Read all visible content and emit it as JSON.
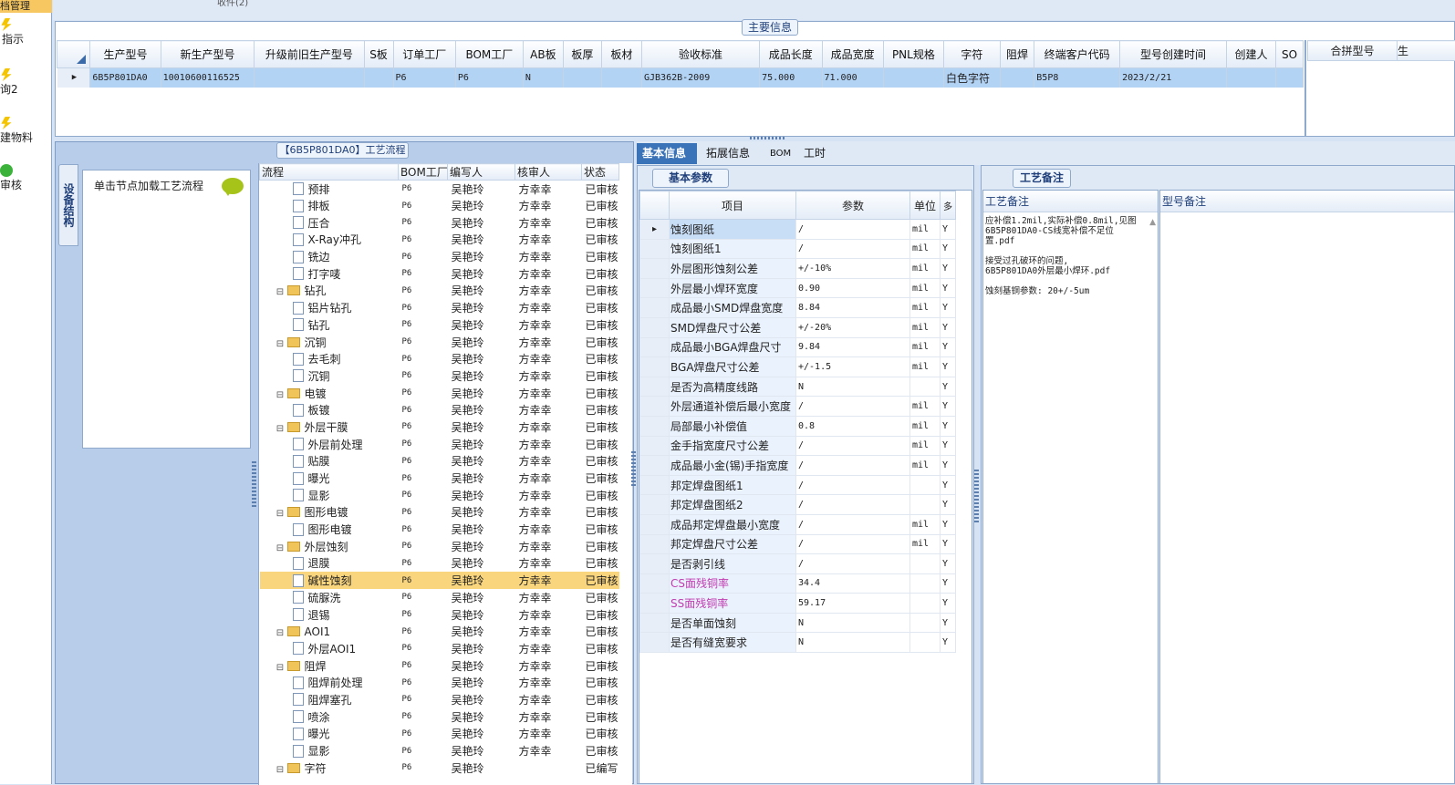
{
  "leftnav": {
    "top_label": "档管理",
    "items": [
      "指示",
      "询2",
      "建物料",
      "审核"
    ]
  },
  "topstrip": {
    "text": "收件(2)"
  },
  "main": {
    "title": "主要信息",
    "columns": [
      "生产型号",
      "新生产型号",
      "升级前旧生产型号",
      "S板",
      "订单工厂",
      "BOM工厂",
      "AB板",
      "板厚",
      "板材",
      "验收标准",
      "成品长度",
      "成品宽度",
      "PNL规格",
      "字符",
      "阻焊",
      "终端客户代码",
      "型号创建时间",
      "创建人",
      "SO"
    ],
    "row": [
      "6B5P801DA0",
      "10010600116525",
      "",
      "",
      "P6",
      "P6",
      "N",
      "",
      "",
      "GJB362B-2009",
      "75.000",
      "71.000",
      "",
      "白色字符",
      "",
      "B5P8",
      "2023/2/21",
      "",
      ""
    ],
    "right_columns": [
      "合拼型号",
      "生"
    ]
  },
  "process": {
    "title": "【6B5P801DA0】工艺流程",
    "vtab": "设备结构",
    "hint": "单击节点加载工艺流程",
    "columns": [
      "流程",
      "BOM工厂",
      "编写人",
      "核审人",
      "状态"
    ],
    "rows": [
      {
        "name": "预排",
        "lvl": 2,
        "fold": false,
        "bom": "P6",
        "writer": "吴艳玲",
        "checker": "方幸幸",
        "status": "已审核"
      },
      {
        "name": "排板",
        "lvl": 2,
        "fold": false,
        "bom": "P6",
        "writer": "吴艳玲",
        "checker": "方幸幸",
        "status": "已审核"
      },
      {
        "name": "压合",
        "lvl": 2,
        "fold": false,
        "bom": "P6",
        "writer": "吴艳玲",
        "checker": "方幸幸",
        "status": "已审核"
      },
      {
        "name": "X-Ray冲孔",
        "lvl": 2,
        "fold": false,
        "bom": "P6",
        "writer": "吴艳玲",
        "checker": "方幸幸",
        "status": "已审核"
      },
      {
        "name": "铣边",
        "lvl": 2,
        "fold": false,
        "bom": "P6",
        "writer": "吴艳玲",
        "checker": "方幸幸",
        "status": "已审核"
      },
      {
        "name": "打字唛",
        "lvl": 2,
        "fold": false,
        "bom": "P6",
        "writer": "吴艳玲",
        "checker": "方幸幸",
        "status": "已审核"
      },
      {
        "name": "钻孔",
        "lvl": 1,
        "fold": true,
        "bom": "P6",
        "writer": "吴艳玲",
        "checker": "方幸幸",
        "status": "已审核"
      },
      {
        "name": "铝片钻孔",
        "lvl": 2,
        "fold": false,
        "bom": "P6",
        "writer": "吴艳玲",
        "checker": "方幸幸",
        "status": "已审核"
      },
      {
        "name": "钻孔",
        "lvl": 2,
        "fold": false,
        "bom": "P6",
        "writer": "吴艳玲",
        "checker": "方幸幸",
        "status": "已审核"
      },
      {
        "name": "沉铜",
        "lvl": 1,
        "fold": true,
        "bom": "P6",
        "writer": "吴艳玲",
        "checker": "方幸幸",
        "status": "已审核"
      },
      {
        "name": "去毛刺",
        "lvl": 2,
        "fold": false,
        "bom": "P6",
        "writer": "吴艳玲",
        "checker": "方幸幸",
        "status": "已审核"
      },
      {
        "name": "沉铜",
        "lvl": 2,
        "fold": false,
        "bom": "P6",
        "writer": "吴艳玲",
        "checker": "方幸幸",
        "status": "已审核"
      },
      {
        "name": "电镀",
        "lvl": 1,
        "fold": true,
        "bom": "P6",
        "writer": "吴艳玲",
        "checker": "方幸幸",
        "status": "已审核"
      },
      {
        "name": "板镀",
        "lvl": 2,
        "fold": false,
        "bom": "P6",
        "writer": "吴艳玲",
        "checker": "方幸幸",
        "status": "已审核"
      },
      {
        "name": "外层干膜",
        "lvl": 1,
        "fold": true,
        "bom": "P6",
        "writer": "吴艳玲",
        "checker": "方幸幸",
        "status": "已审核"
      },
      {
        "name": "外层前处理",
        "lvl": 2,
        "fold": false,
        "bom": "P6",
        "writer": "吴艳玲",
        "checker": "方幸幸",
        "status": "已审核"
      },
      {
        "name": "贴膜",
        "lvl": 2,
        "fold": false,
        "bom": "P6",
        "writer": "吴艳玲",
        "checker": "方幸幸",
        "status": "已审核"
      },
      {
        "name": "曝光",
        "lvl": 2,
        "fold": false,
        "bom": "P6",
        "writer": "吴艳玲",
        "checker": "方幸幸",
        "status": "已审核"
      },
      {
        "name": "显影",
        "lvl": 2,
        "fold": false,
        "bom": "P6",
        "writer": "吴艳玲",
        "checker": "方幸幸",
        "status": "已审核"
      },
      {
        "name": "图形电镀",
        "lvl": 1,
        "fold": true,
        "bom": "P6",
        "writer": "吴艳玲",
        "checker": "方幸幸",
        "status": "已审核"
      },
      {
        "name": "图形电镀",
        "lvl": 2,
        "fold": false,
        "bom": "P6",
        "writer": "吴艳玲",
        "checker": "方幸幸",
        "status": "已审核"
      },
      {
        "name": "外层蚀刻",
        "lvl": 1,
        "fold": true,
        "bom": "P6",
        "writer": "吴艳玲",
        "checker": "方幸幸",
        "status": "已审核"
      },
      {
        "name": "退膜",
        "lvl": 2,
        "fold": false,
        "bom": "P6",
        "writer": "吴艳玲",
        "checker": "方幸幸",
        "status": "已审核"
      },
      {
        "name": "碱性蚀刻",
        "lvl": 2,
        "fold": false,
        "bom": "P6",
        "writer": "吴艳玲",
        "checker": "方幸幸",
        "status": "已审核",
        "selected": true
      },
      {
        "name": "硫脲洗",
        "lvl": 2,
        "fold": false,
        "bom": "P6",
        "writer": "吴艳玲",
        "checker": "方幸幸",
        "status": "已审核"
      },
      {
        "name": "退锡",
        "lvl": 2,
        "fold": false,
        "bom": "P6",
        "writer": "吴艳玲",
        "checker": "方幸幸",
        "status": "已审核"
      },
      {
        "name": "AOI1",
        "lvl": 1,
        "fold": true,
        "bom": "P6",
        "writer": "吴艳玲",
        "checker": "方幸幸",
        "status": "已审核"
      },
      {
        "name": "外层AOI1",
        "lvl": 2,
        "fold": false,
        "bom": "P6",
        "writer": "吴艳玲",
        "checker": "方幸幸",
        "status": "已审核"
      },
      {
        "name": "阻焊",
        "lvl": 1,
        "fold": true,
        "bom": "P6",
        "writer": "吴艳玲",
        "checker": "方幸幸",
        "status": "已审核"
      },
      {
        "name": "阻焊前处理",
        "lvl": 2,
        "fold": false,
        "bom": "P6",
        "writer": "吴艳玲",
        "checker": "方幸幸",
        "status": "已审核"
      },
      {
        "name": "阻焊塞孔",
        "lvl": 2,
        "fold": false,
        "bom": "P6",
        "writer": "吴艳玲",
        "checker": "方幸幸",
        "status": "已审核"
      },
      {
        "name": "喷涂",
        "lvl": 2,
        "fold": false,
        "bom": "P6",
        "writer": "吴艳玲",
        "checker": "方幸幸",
        "status": "已审核"
      },
      {
        "name": "曝光",
        "lvl": 2,
        "fold": false,
        "bom": "P6",
        "writer": "吴艳玲",
        "checker": "方幸幸",
        "status": "已审核"
      },
      {
        "name": "显影",
        "lvl": 2,
        "fold": false,
        "bom": "P6",
        "writer": "吴艳玲",
        "checker": "方幸幸",
        "status": "已审核"
      },
      {
        "name": "字符",
        "lvl": 1,
        "fold": true,
        "bom": "P6",
        "writer": "吴艳玲",
        "checker": "",
        "status": "已编写"
      }
    ]
  },
  "tabs": [
    "基本信息",
    "拓展信息",
    "BOM",
    "工时"
  ],
  "basic": {
    "title": "基本参数",
    "columns": [
      "项目",
      "参数",
      "单位",
      "多"
    ],
    "rows": [
      {
        "item": "蚀刻图纸",
        "val": "/",
        "unit": "mil",
        "flag": "Y"
      },
      {
        "item": "蚀刻图纸1",
        "val": "/",
        "unit": "mil",
        "flag": "Y"
      },
      {
        "item": "外层图形蚀刻公差",
        "val": "+/-10%",
        "unit": "mil",
        "flag": "Y"
      },
      {
        "item": "外层最小焊环宽度",
        "val": "0.90",
        "unit": "mil",
        "flag": "Y"
      },
      {
        "item": "成品最小SMD焊盘宽度",
        "val": "8.84",
        "unit": "mil",
        "flag": "Y"
      },
      {
        "item": "SMD焊盘尺寸公差",
        "val": "+/-20%",
        "unit": "mil",
        "flag": "Y"
      },
      {
        "item": "成品最小BGA焊盘尺寸",
        "val": "9.84",
        "unit": "mil",
        "flag": "Y"
      },
      {
        "item": "BGA焊盘尺寸公差",
        "val": "+/-1.5",
        "unit": "mil",
        "flag": "Y"
      },
      {
        "item": "是否为高精度线路",
        "val": "N",
        "unit": "",
        "flag": "Y"
      },
      {
        "item": "外层通道补偿后最小宽度",
        "val": "/",
        "unit": "mil",
        "flag": "Y"
      },
      {
        "item": "局部最小补偿值",
        "val": "0.8",
        "unit": "mil",
        "flag": "Y"
      },
      {
        "item": "金手指宽度尺寸公差",
        "val": "/",
        "unit": "mil",
        "flag": "Y"
      },
      {
        "item": "成品最小金(锡)手指宽度",
        "val": "/",
        "unit": "mil",
        "flag": "Y"
      },
      {
        "item": "邦定焊盘图纸1",
        "val": "/",
        "unit": "",
        "flag": "Y"
      },
      {
        "item": "邦定焊盘图纸2",
        "val": "/",
        "unit": "",
        "flag": "Y"
      },
      {
        "item": "成品邦定焊盘最小宽度",
        "val": "/",
        "unit": "mil",
        "flag": "Y"
      },
      {
        "item": "邦定焊盘尺寸公差",
        "val": "/",
        "unit": "mil",
        "flag": "Y"
      },
      {
        "item": "是否剥引线",
        "val": "/",
        "unit": "",
        "flag": "Y"
      },
      {
        "item": "CS面残铜率",
        "val": "34.4",
        "unit": "",
        "flag": "Y",
        "pink": true
      },
      {
        "item": "SS面残铜率",
        "val": "59.17",
        "unit": "",
        "flag": "Y",
        "pink": true
      },
      {
        "item": "是否单面蚀刻",
        "val": "N",
        "unit": "",
        "flag": "Y"
      },
      {
        "item": "是否有缝宽要求",
        "val": "N",
        "unit": "",
        "flag": "Y"
      }
    ]
  },
  "notes": {
    "title": "工艺备注",
    "col1_header": "工艺备注",
    "col2_header": "型号备注",
    "text": "应补偿1.2mil,实际补偿0.8mil,见图6B5P801DA0-CS线宽补偿不足位置.pdf\n\n接受过孔破环的问题,\n6B5P801DA0外层最小焊环.pdf\n\n蚀刻基铜参数: 20+/-5um"
  }
}
